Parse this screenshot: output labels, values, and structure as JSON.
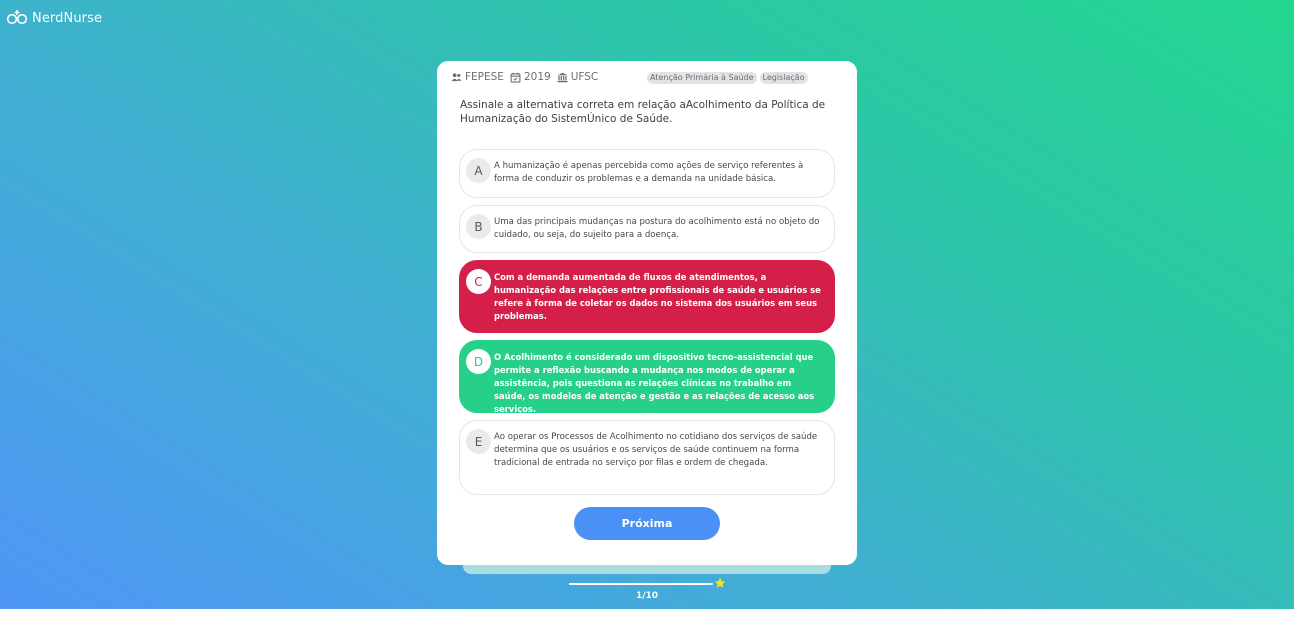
{
  "app": {
    "name": "NerdNurse"
  },
  "question": {
    "meta": [
      {
        "icon": "users-icon",
        "label": "FEPESE"
      },
      {
        "icon": "calendar-icon",
        "label": "2019"
      },
      {
        "icon": "institution-icon",
        "label": "UFSC"
      }
    ],
    "tags": [
      "Atenção Primária à Saúde",
      "Legislação"
    ],
    "statement": "Assinale a alternativa correta em relação aAcolhimento da Política de Humanização do SistemÚnico de Saúde.",
    "options": [
      {
        "letter": "A",
        "state": "neutral",
        "text": "A humanização é apenas percebida como ações de serviço referentes à forma de conduzir os problemas e a demanda na unidade básica."
      },
      {
        "letter": "B",
        "state": "neutral",
        "text": "Uma das principais mudanças na postura do acolhimento está no objeto do cuidado, ou seja, do sujeito para a doença."
      },
      {
        "letter": "C",
        "state": "wrong",
        "text": "Com a demanda aumentada de fluxos de atendimentos, a humanização das relações entre profissionais de saúde e usuários se refere à forma de coletar os dados no sistema dos usuários em seus problemas."
      },
      {
        "letter": "D",
        "state": "correct",
        "text": "O Acolhimento é considerado um dispositivo tecno-assistencial que permite a reflexão buscando a mudança nos modos de operar a assistência, pois questiona as relações clínicas no trabalho em saúde, os modelos de atenção e gestão e as relações de acesso aos serviços."
      },
      {
        "letter": "E",
        "state": "neutral",
        "text": "Ao operar os Processos de Acolhimento no cotidiano dos serviços de saúde determina que os usuários e os serviços de saúde continuem na forma tradicional de entrada no serviço por filas e ordem de chegada."
      }
    ],
    "next_label": "Próxima"
  },
  "progress": {
    "label": "1/10",
    "current": 1,
    "total": 10,
    "star_color": "#f5e21b"
  },
  "colors": {
    "wrong": "#d42048",
    "correct": "#26d088",
    "button": "#4a90f5"
  }
}
